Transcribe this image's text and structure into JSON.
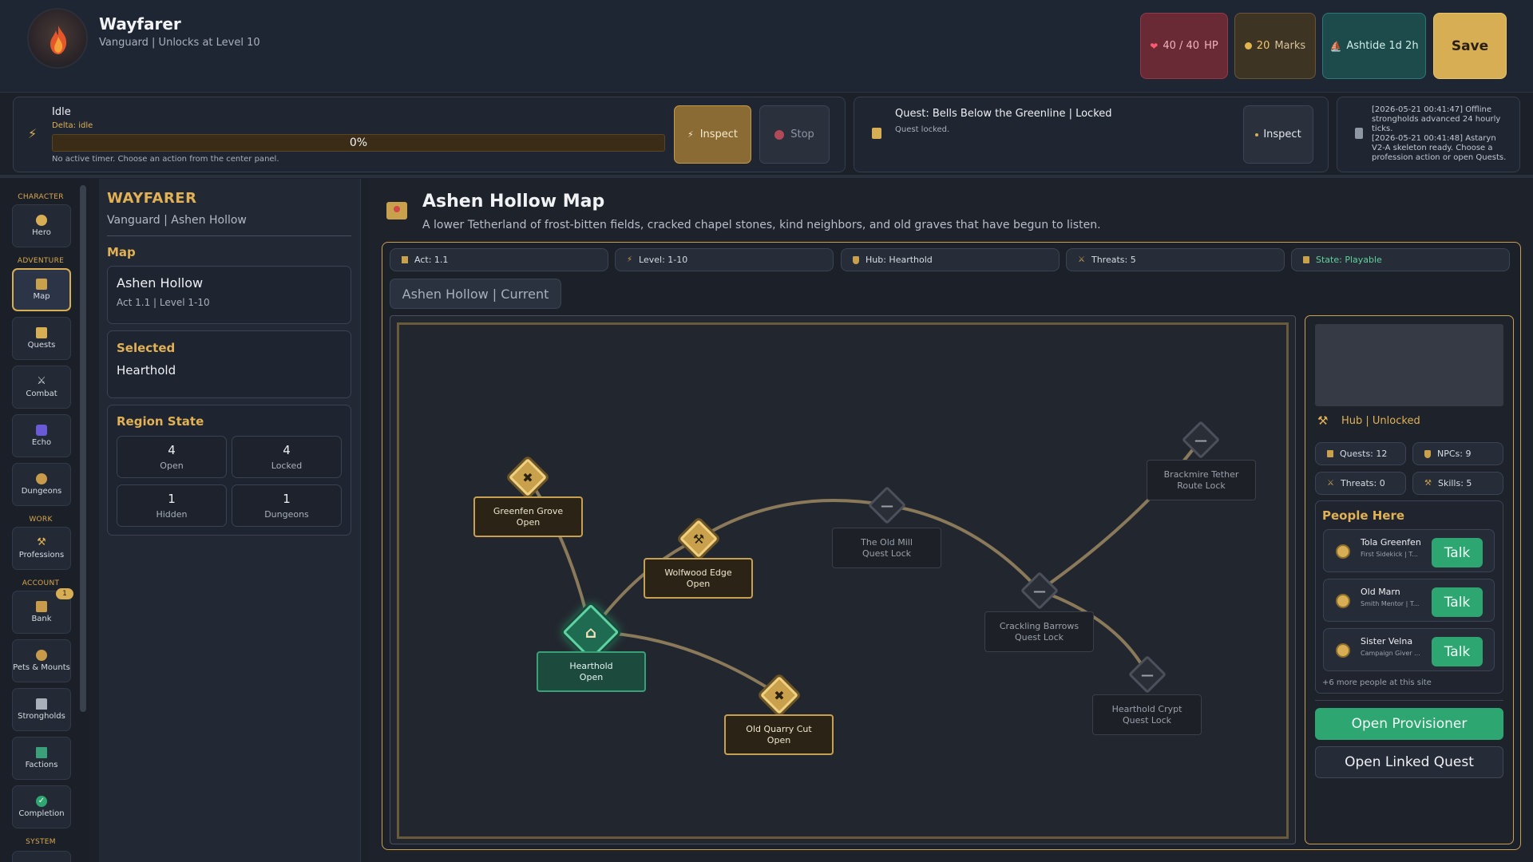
{
  "header": {
    "name": "Wayfarer",
    "subtitle": "Vanguard | Unlocks at Level 10",
    "hp": "40 / 40",
    "hp_unit": "HP",
    "marks": "20",
    "marks_unit": "Marks",
    "time": "Ashtide 1d 2h",
    "save_label": "Save"
  },
  "status": {
    "state": "Idle",
    "delta": "Delta: idle",
    "progress": 0,
    "progress_text": "0%",
    "hint": "No active timer. Choose an action from the center panel.",
    "inspect_label": "Inspect",
    "stop_label": "Stop"
  },
  "quest_status": {
    "title": "Quest: Bells Below the Greenline | Locked",
    "note": "Quest locked.",
    "inspect_label": "Inspect"
  },
  "log": [
    "[2026-05-21 00:41:47] Offline strongholds advanced 24 hourly ticks.",
    "[2026-05-21 00:41:48] Astaryn V2-A skeleton ready. Choose a profession action or open Quests."
  ],
  "sidebar": {
    "sections": {
      "character": "CHARACTER",
      "adventure": "ADVENTURE",
      "work": "WORK",
      "account": "ACCOUNT",
      "system": "SYSTEM"
    },
    "items": {
      "hero": "Hero",
      "map": "Map",
      "quests": "Quests",
      "combat": "Combat",
      "echo": "Echo",
      "dungeons": "Dungeons",
      "professions": "Professions",
      "bank": "Bank",
      "pets": "Pets & Mounts",
      "strongholds": "Strongholds",
      "factions": "Factions",
      "completion": "Completion"
    },
    "bank_badge": "1"
  },
  "left": {
    "title": "WAYFARER",
    "subtitle": "Vanguard | Ashen Hollow",
    "map_heading": "Map",
    "region_name": "Ashen Hollow",
    "region_sub": "Act 1.1 | Level 1-10",
    "selected_heading": "Selected",
    "selected_value": "Hearthold",
    "state_heading": "Region State",
    "stats": [
      {
        "value": "4",
        "label": "Open"
      },
      {
        "value": "4",
        "label": "Locked"
      },
      {
        "value": "1",
        "label": "Hidden"
      },
      {
        "value": "1",
        "label": "Dungeons"
      }
    ]
  },
  "main": {
    "title": "Ashen Hollow Map",
    "description": "A lower Tetherland of frost-bitten fields, cracked chapel stones, kind neighbors, and old graves that have begun to listen.",
    "chips": [
      "Act: 1.1",
      "Level: 1-10",
      "Hub: Hearthold",
      "Threats: 5",
      "State: Playable"
    ],
    "tab": "Ashen Hollow | Current"
  },
  "map_nodes": [
    {
      "name": "Greenfen Grove",
      "state": "Open"
    },
    {
      "name": "Wolfwood Edge",
      "state": "Open"
    },
    {
      "name": "Hearthold",
      "state": "Open"
    },
    {
      "name": "Old Quarry Cut",
      "state": "Open"
    },
    {
      "name": "The Old Mill",
      "state": "Quest Lock"
    },
    {
      "name": "Crackling Barrows",
      "state": "Quest Lock"
    },
    {
      "name": "Brackmire Tether",
      "state": "Route Lock"
    },
    {
      "name": "Hearthold Crypt",
      "state": "Quest Lock"
    }
  ],
  "right": {
    "hub_label": "Hub | Unlocked",
    "chips": [
      "Quests: 12",
      "NPCs: 9",
      "Threats: 0",
      "Skills: 5"
    ],
    "people_heading": "People Here",
    "people": [
      {
        "name": "Tola Greenfen",
        "role": "First Sidekick | T...",
        "talk": "Talk"
      },
      {
        "name": "Old Marn",
        "role": "Smith Mentor | T...",
        "talk": "Talk"
      },
      {
        "name": "Sister Velna",
        "role": "Campaign Giver ...",
        "talk": "Talk"
      }
    ],
    "more": "+6 more people at this site",
    "open_provisioner": "Open Provisioner",
    "open_linked_quest": "Open Linked Quest"
  }
}
